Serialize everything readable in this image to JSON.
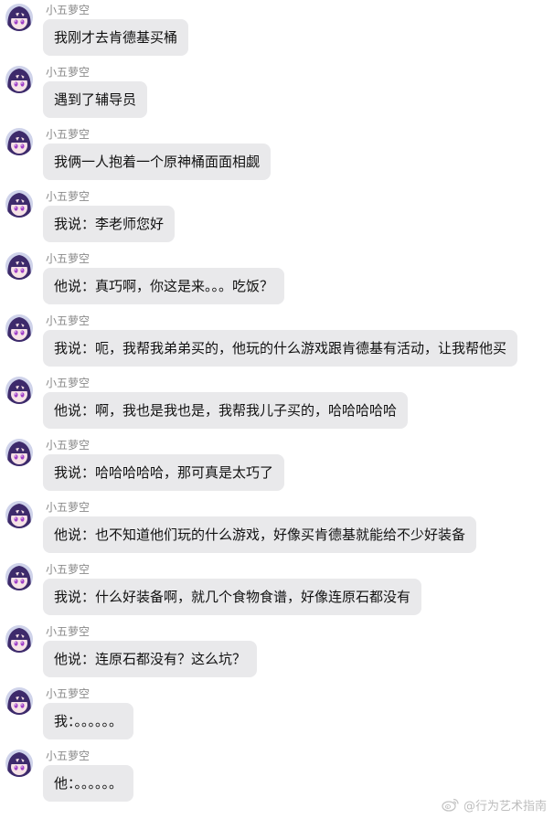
{
  "sender_name": "小五萝空",
  "messages": [
    {
      "text": "我刚才去肯德基买桶"
    },
    {
      "text": "遇到了辅导员"
    },
    {
      "text": "我俩一人抱着一个原神桶面面相觑"
    },
    {
      "text": "我说：李老师您好"
    },
    {
      "text": "他说：真巧啊，你这是来。。。吃饭？"
    },
    {
      "text": "我说：呃，我帮我弟弟买的，他玩的什么游戏跟肯德基有活动，让我帮他买"
    },
    {
      "text": "他说：啊，我也是我也是，我帮我儿子买的，哈哈哈哈哈"
    },
    {
      "text": "我说：哈哈哈哈哈，那可真是太巧了"
    },
    {
      "text": "他说：也不知道他们玩的什么游戏，好像买肯德基就能给不少好装备"
    },
    {
      "text": "我说：什么好装备啊，就几个食物食谱，好像连原石都没有"
    },
    {
      "text": "他说：连原石都没有？这么坑？"
    },
    {
      "text": "我：。。。。。。"
    },
    {
      "text": "他：。。。。。。"
    }
  ],
  "watermark": {
    "icon": "weibo-icon",
    "text": "@行为艺术指南"
  },
  "colors": {
    "bubble": "#e9e9eb",
    "name": "#8a8a8a",
    "text": "#111111",
    "avatar_hair": "#3d2a6b",
    "avatar_eyes": "#a040c8"
  }
}
